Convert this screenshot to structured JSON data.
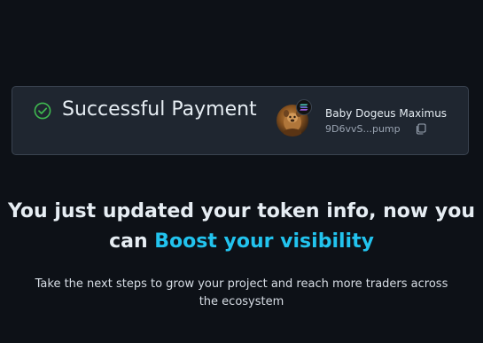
{
  "payment": {
    "status_title": "Successful Payment",
    "status_icon": "check-circle-icon"
  },
  "token": {
    "name": "Baby Dogeus Maximus",
    "address": "9D6vvS...pump",
    "chain_icon": "solana-icon",
    "copy_icon": "copy-icon"
  },
  "headline": {
    "line1": "You just updated your token info, now you",
    "line2_prefix": "can ",
    "line2_accent": "Boost your visibility"
  },
  "subtext": {
    "line1": "Take the next steps to grow your project and reach more traders across",
    "line2": "the ecosystem"
  },
  "colors": {
    "background": "#0d1117",
    "card": "#1f2630",
    "success": "#3fb950",
    "accent": "#22c3ee"
  }
}
